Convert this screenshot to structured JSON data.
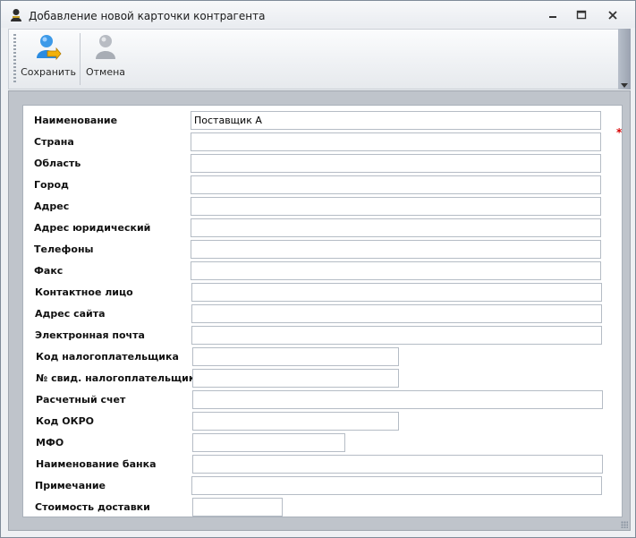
{
  "window": {
    "title": "Добавление новой карточки контрагента"
  },
  "toolbar": {
    "save_label": "Сохранить",
    "cancel_label": "Отмена"
  },
  "form": {
    "fields": [
      {
        "label": "Наименование",
        "value": "Поставщик А"
      },
      {
        "label": "Страна",
        "value": "",
        "required": true
      },
      {
        "label": "Область",
        "value": ""
      },
      {
        "label": "Город",
        "value": ""
      },
      {
        "label": "Адрес",
        "value": ""
      },
      {
        "label": "Адрес юридический",
        "value": ""
      },
      {
        "label": "Телефоны",
        "value": ""
      },
      {
        "label": "Факс",
        "value": ""
      },
      {
        "label": "Контактное лицо",
        "value": ""
      },
      {
        "label": "Адрес сайта",
        "value": ""
      },
      {
        "label": "Электронная почта",
        "value": ""
      },
      {
        "label": "Код налогоплательщика",
        "value": ""
      },
      {
        "label": "№ свид. налогоплательщика",
        "value": ""
      },
      {
        "label": "Расчетный счет",
        "value": ""
      },
      {
        "label": "Код ОКРО",
        "value": ""
      },
      {
        "label": "МФО",
        "value": ""
      },
      {
        "label": "Наименование банка",
        "value": ""
      },
      {
        "label": "Примечание",
        "value": ""
      },
      {
        "label": "Стоимость доставки",
        "value": ""
      }
    ],
    "required_marker": "*"
  },
  "colors": {
    "required": "#d80000",
    "save_icon_blue": "#2b8be0",
    "save_icon_yellow": "#f2b10a",
    "cancel_icon_gray": "#a8adb5"
  }
}
